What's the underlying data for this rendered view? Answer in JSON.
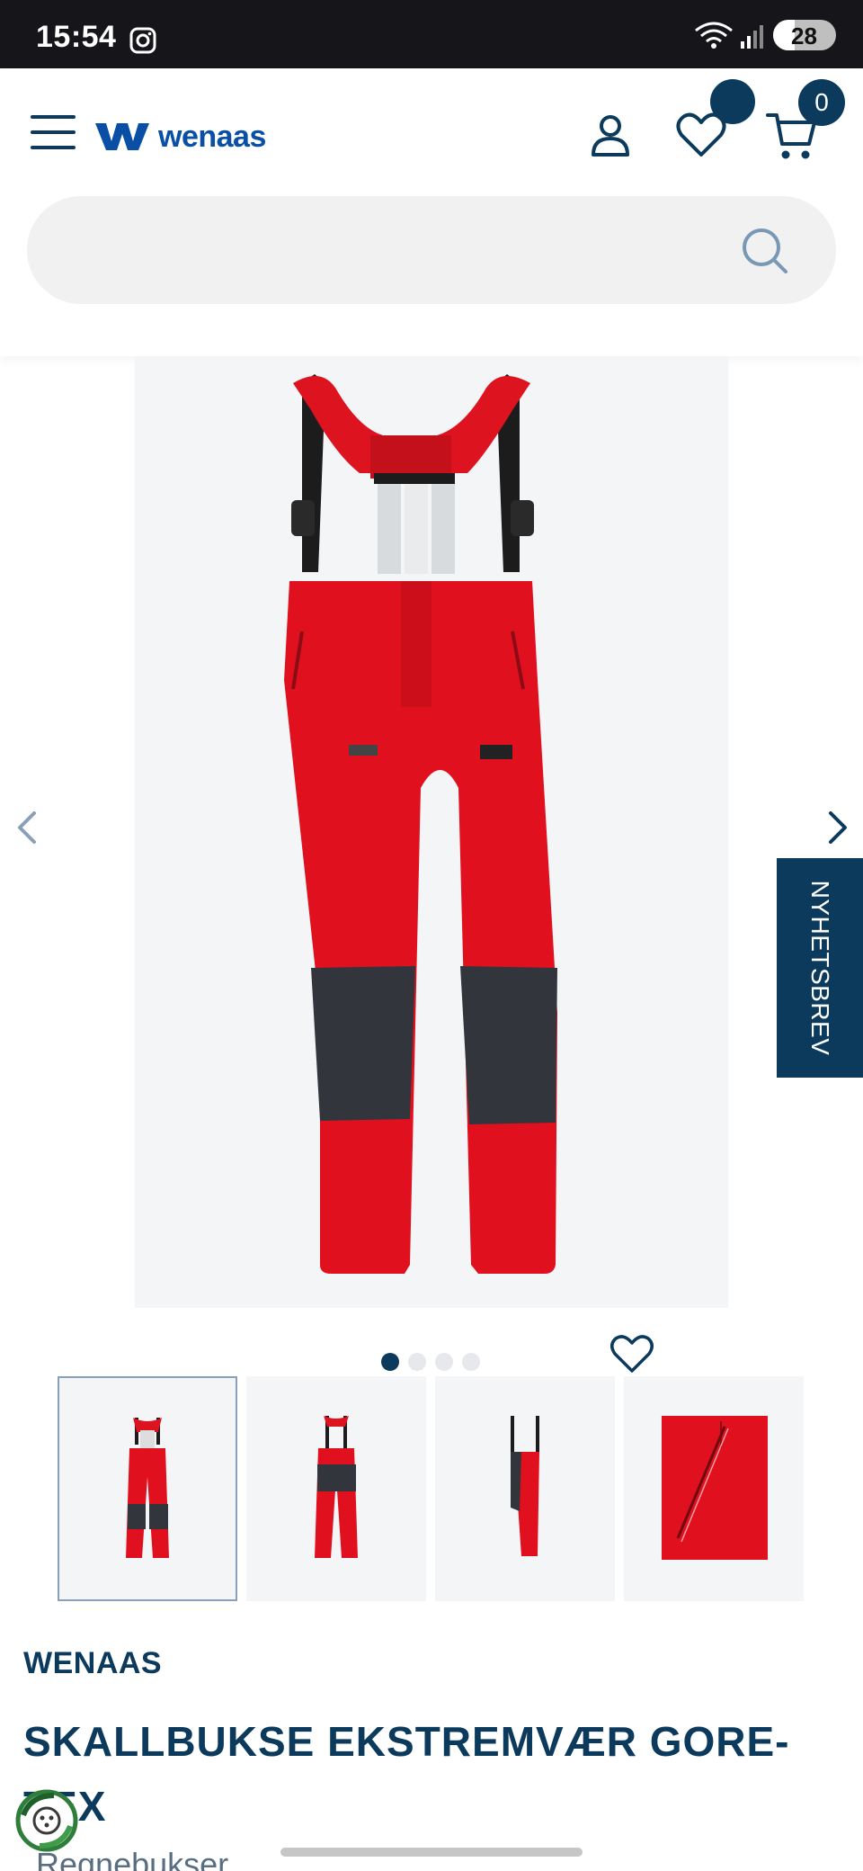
{
  "status_bar": {
    "time": "15:54",
    "battery": "28"
  },
  "header": {
    "logo_text": "wenaas",
    "cart_count": "0",
    "search": {
      "placeholder": ""
    }
  },
  "product": {
    "newsletter_label": "NYHETSBREV",
    "brand": "WENAAS",
    "title": "SKALLBUKSE EKSTREMVÆR GORE-TEX",
    "category": "Regnebukser",
    "image_count": 4,
    "active_image": 1,
    "colors": {
      "primary": "#0b3a5c",
      "product_red": "#e0101e",
      "panel_dark": "#32353c"
    }
  }
}
